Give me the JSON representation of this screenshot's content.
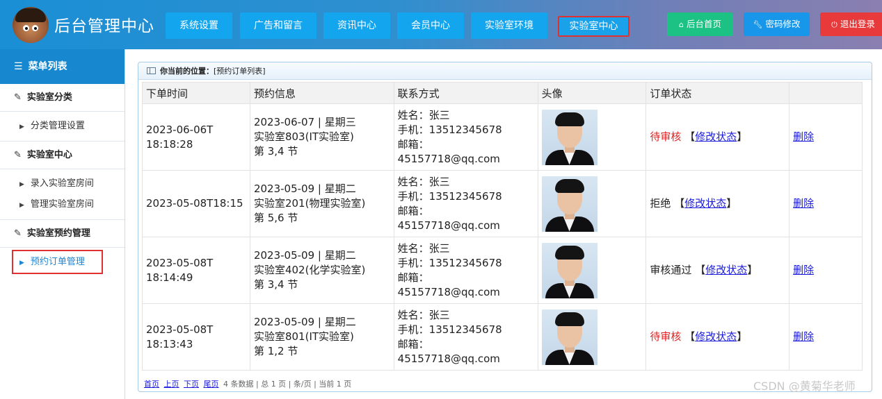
{
  "header": {
    "title": "后台管理中心",
    "nav": [
      "系统设置",
      "广告和留言",
      "资讯中心",
      "会员中心",
      "实验室环境",
      "实验室中心"
    ],
    "home_label": "后台首页",
    "password_label": "密码修改",
    "logout_label": "退出登录",
    "colors": {
      "nav": "#13a6ef",
      "home": "#1cc283",
      "password": "#1897ea",
      "logout": "#e83a3a",
      "highlight": "#e03030"
    }
  },
  "sidebar": {
    "title": "菜单列表",
    "groups": [
      {
        "label": "实验室分类",
        "items": [
          "分类管理设置"
        ]
      },
      {
        "label": "实验室中心",
        "items": [
          "录入实验室房间",
          "管理实验室房间"
        ]
      },
      {
        "label": "实验室预约管理",
        "items": [
          "预约订单管理"
        ]
      }
    ]
  },
  "panel": {
    "location_label": "你当前的位置：",
    "location_value": "[预约订单列表]"
  },
  "table": {
    "headers": [
      "下单时间",
      "预约信息",
      "联系方式",
      "头像",
      "订单状态",
      ""
    ],
    "rows": [
      {
        "time": "2023-06-06T18:18:28",
        "booking": [
          "2023-06-07 | 星期三",
          "实验室803(IT实验室)",
          "第 3,4 节"
        ],
        "contact": [
          "姓名：张三",
          "手机：13512345678",
          "邮箱：",
          "45157718@qq.com"
        ],
        "status": "待审核",
        "modify": "修改状态",
        "delete": "删除"
      },
      {
        "time": "2023-05-08T18:15",
        "booking": [
          "2023-05-09 | 星期二",
          "实验室201(物理实验室)",
          "第 5,6 节"
        ],
        "contact": [
          "姓名：张三",
          "手机：13512345678",
          "邮箱：",
          "45157718@qq.com"
        ],
        "status": "拒绝",
        "modify": "修改状态",
        "delete": "删除"
      },
      {
        "time": "2023-05-08T18:14:49",
        "booking": [
          "2023-05-09 | 星期二",
          "实验室402(化学实验室)",
          "第 3,4 节"
        ],
        "contact": [
          "姓名：张三",
          "手机：13512345678",
          "邮箱：",
          "45157718@qq.com"
        ],
        "status": "审核通过",
        "modify": "修改状态",
        "delete": "删除"
      },
      {
        "time": "2023-05-08T18:13:43",
        "booking": [
          "2023-05-09 | 星期二",
          "实验室801(IT实验室)",
          "第 1,2 节"
        ],
        "contact": [
          "姓名：张三",
          "手机：13512345678",
          "邮箱：",
          "45157718@qq.com"
        ],
        "status": "待审核",
        "modify": "修改状态",
        "delete": "删除"
      }
    ]
  },
  "pager": {
    "first": "首页",
    "prev": "上页",
    "next": "下页",
    "last": "尾页",
    "summary": "4 条数据 | 总 1 页 | 条/页 | 当前 1 页"
  },
  "watermark": "CSDN @黄菊华老师"
}
